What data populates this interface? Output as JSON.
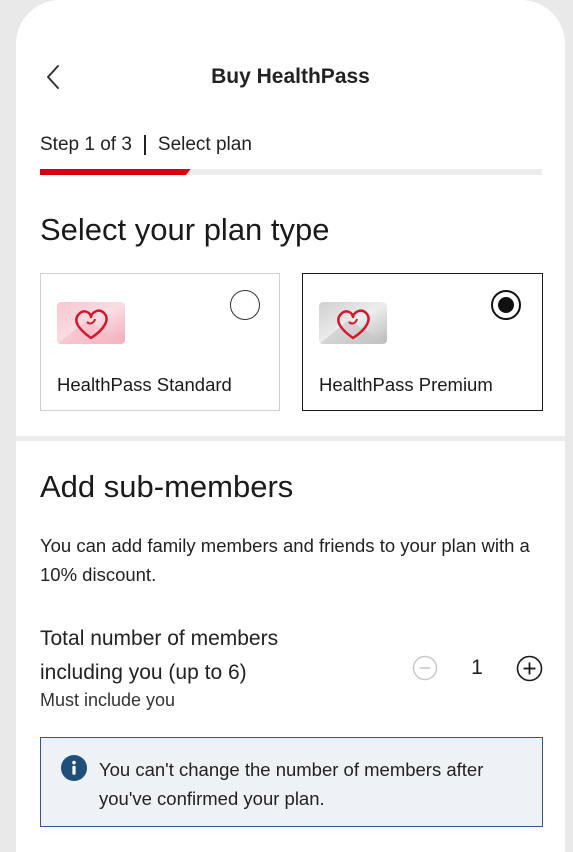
{
  "header": {
    "title": "Buy HealthPass"
  },
  "step": {
    "counter": "Step 1 of 3",
    "name": "Select plan",
    "progress": 0.3
  },
  "plan_section": {
    "title": "Select your plan type",
    "plans": [
      {
        "label": "HealthPass Standard",
        "selected": false
      },
      {
        "label": "HealthPass Premium",
        "selected": true
      }
    ]
  },
  "members_section": {
    "title": "Add sub-members",
    "description": "You can add family members and friends to your plan with a 10% discount.",
    "total_label": "Total number of members including you (up to 6)",
    "sub_label": "Must include you",
    "count": "1"
  },
  "notice": {
    "text": "You can't change the number of members after you've confirmed your plan."
  },
  "colors": {
    "accent": "#db0011",
    "notice_border": "#305a85",
    "notice_bg": "#eef1f6",
    "info_icon": "#1f4e79"
  }
}
